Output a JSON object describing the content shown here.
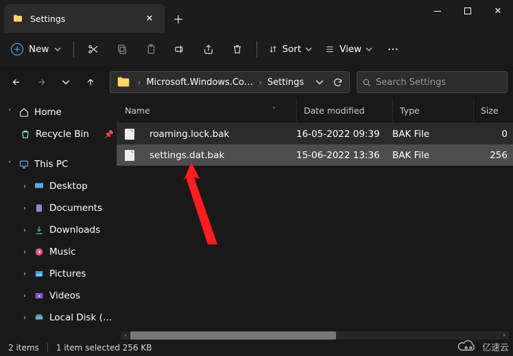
{
  "tab": {
    "title": "Settings"
  },
  "toolbar": {
    "new_label": "New",
    "sort_label": "Sort",
    "view_label": "View"
  },
  "breadcrumb": {
    "seg1": "Microsoft.Windows.Cont…",
    "seg2": "Settings"
  },
  "search": {
    "placeholder": "Search Settings"
  },
  "sidebar": {
    "home": "Home",
    "recycle": "Recycle Bin",
    "thispc": "This PC",
    "desktop": "Desktop",
    "documents": "Documents",
    "downloads": "Downloads",
    "music": "Music",
    "pictures": "Pictures",
    "videos": "Videos",
    "localdisk": "Local Disk (C:)"
  },
  "columns": {
    "name": "Name",
    "date": "Date modified",
    "type": "Type",
    "size": "Size",
    "sort_indicator": "˄"
  },
  "rows": [
    {
      "name": "roaming.lock.bak",
      "date": "16-05-2022 09:39",
      "type": "BAK File",
      "size": "0"
    },
    {
      "name": "settings.dat.bak",
      "date": "15-06-2022 13:36",
      "type": "BAK File",
      "size": "256"
    }
  ],
  "status": {
    "items": "2 items",
    "selected": "1 item selected  256 KB"
  },
  "watermark": "亿速云"
}
